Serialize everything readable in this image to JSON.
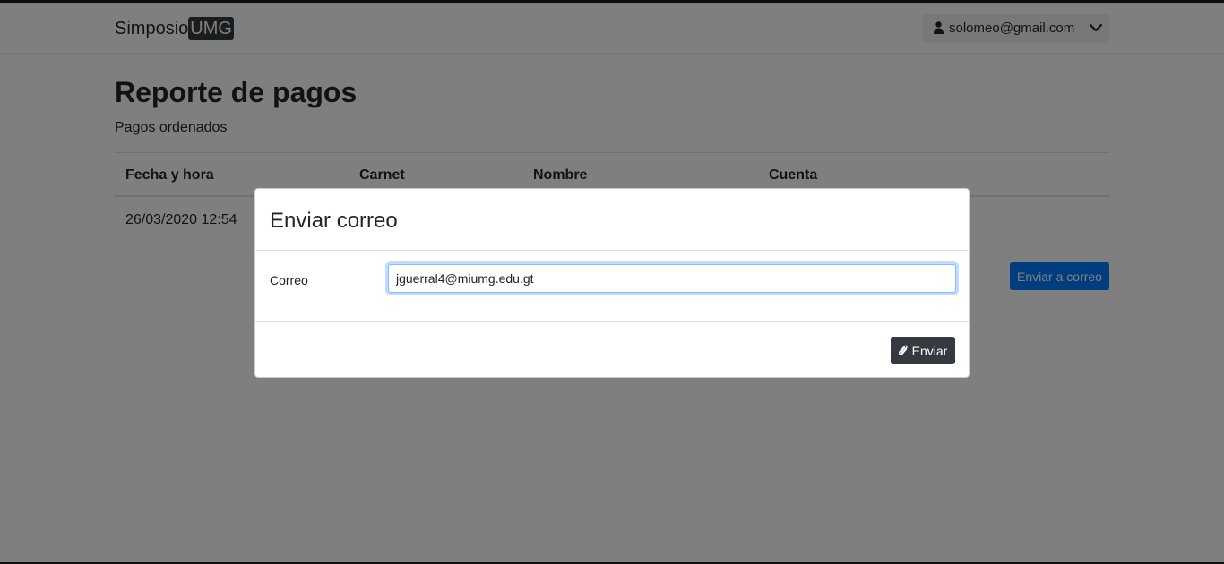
{
  "navbar": {
    "brand_text": "Simposio",
    "brand_highlight": "UMG",
    "user_email": "solomeo@gmail.com",
    "user_icon": "user-icon",
    "dropdown_icon": "chevron-down-icon"
  },
  "page": {
    "title": "Reporte de pagos",
    "subtitle": "Pagos ordenados",
    "table": {
      "headers": [
        "Fecha y hora",
        "Carnet",
        "Nombre",
        "Cuenta"
      ],
      "rows": [
        [
          "26/03/2020 12:54",
          "",
          "",
          ""
        ]
      ]
    },
    "send_button_label": "Enviar a correo"
  },
  "modal": {
    "title": "Enviar correo",
    "field_label": "Correo",
    "email_value": "jguerral4@miumg.edu.gt",
    "submit_label": "Enviar",
    "submit_icon": "paperclip-icon"
  },
  "colors": {
    "primary": "#007bff",
    "dark": "#343a40",
    "backdrop": "rgba(0,0,0,0.5)"
  }
}
